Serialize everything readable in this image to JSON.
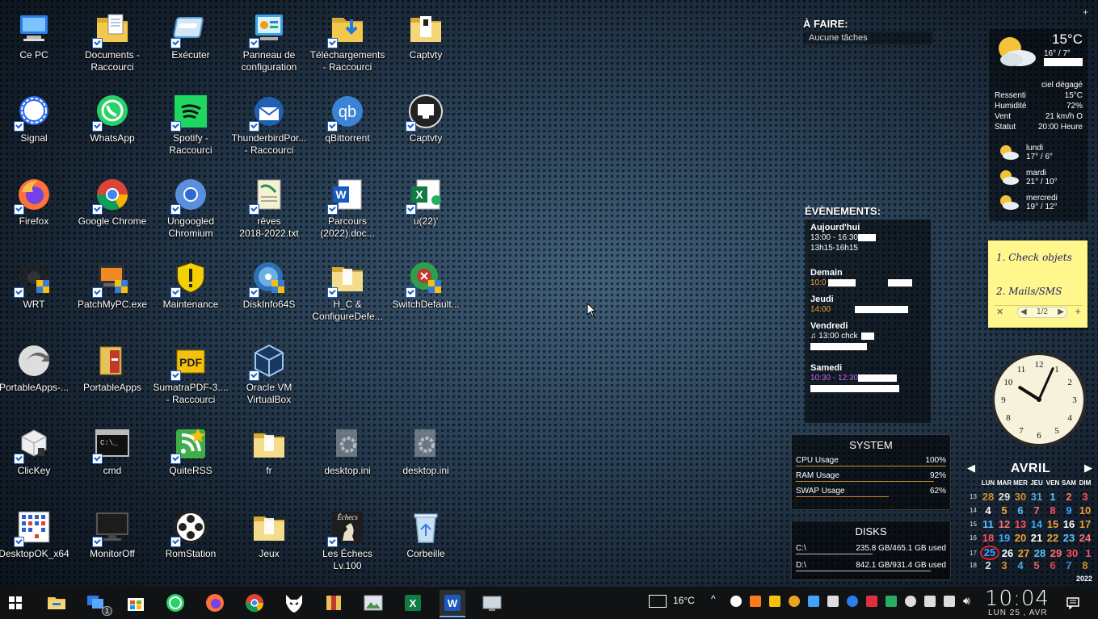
{
  "desktop": {
    "icons": [
      {
        "label": "Ce PC",
        "icon": "computer-icon",
        "shortcut": false
      },
      {
        "label": "Documents -\nRaccourci",
        "icon": "documents-folder-icon",
        "shortcut": true
      },
      {
        "label": "Exécuter",
        "icon": "run-icon",
        "shortcut": true
      },
      {
        "label": "Panneau de\nconfiguration",
        "icon": "control-panel-icon",
        "shortcut": true
      },
      {
        "label": "Téléchargements\n- Raccourci",
        "icon": "downloads-folder-icon",
        "shortcut": true
      },
      {
        "label": "Captvty",
        "icon": "captvty-folder-icon",
        "shortcut": false
      },
      {
        "label": "Signal",
        "icon": "signal-icon",
        "shortcut": true
      },
      {
        "label": "WhatsApp",
        "icon": "whatsapp-icon",
        "shortcut": true
      },
      {
        "label": "Spotify -\nRaccourci",
        "icon": "spotify-icon",
        "shortcut": true
      },
      {
        "label": "ThunderbirdPor...\n- Raccourci",
        "icon": "thunderbird-icon",
        "shortcut": true
      },
      {
        "label": "qBittorrent",
        "icon": "qbittorrent-icon",
        "shortcut": true
      },
      {
        "label": "Captvty",
        "icon": "captvty-icon",
        "shortcut": true
      },
      {
        "label": "Firefox",
        "icon": "firefox-icon",
        "shortcut": true
      },
      {
        "label": "Google Chrome",
        "icon": "chrome-icon",
        "shortcut": true
      },
      {
        "label": "Ungoogled\nChromium",
        "icon": "chromium-icon",
        "shortcut": true
      },
      {
        "label": "rêves\n2018-2022.txt",
        "icon": "text-file-icon",
        "shortcut": true
      },
      {
        "label": "Parcours\n(2022).doc...",
        "icon": "word-document-icon",
        "shortcut": true
      },
      {
        "label": "u(22)'",
        "icon": "excel-document-icon",
        "shortcut": true
      },
      {
        "label": "WRT",
        "icon": "wrt-gear-icon",
        "shortcut": true
      },
      {
        "label": "PatchMyPC.exe",
        "icon": "patchmypc-icon",
        "shortcut": true
      },
      {
        "label": "Maintenance",
        "icon": "warning-shield-icon",
        "shortcut": true
      },
      {
        "label": "DiskInfo64S",
        "icon": "diskinfo-icon",
        "shortcut": true
      },
      {
        "label": "H_C &\nConfigureDefe...",
        "icon": "folder-icon",
        "shortcut": true
      },
      {
        "label": "SwitchDefault...",
        "icon": "switchdefault-icon",
        "shortcut": true
      },
      {
        "label": "PortableApps-...",
        "icon": "portableapps-setup-icon",
        "shortcut": false
      },
      {
        "label": "PortableApps",
        "icon": "portableapps-icon",
        "shortcut": false
      },
      {
        "label": "SumatraPDF-3....\n- Raccourci",
        "icon": "sumatrapdf-icon",
        "shortcut": true
      },
      {
        "label": "Oracle VM\nVirtualBox",
        "icon": "virtualbox-icon",
        "shortcut": true
      },
      {
        "label": "",
        "icon": "",
        "shortcut": false
      },
      {
        "label": "",
        "icon": "",
        "shortcut": false
      },
      {
        "label": "ClicKey",
        "icon": "clickey-icon",
        "shortcut": true
      },
      {
        "label": "cmd",
        "icon": "cmd-icon",
        "shortcut": true
      },
      {
        "label": "QuiteRSS",
        "icon": "quiterss-icon",
        "shortcut": true
      },
      {
        "label": "fr",
        "icon": "folder-icon",
        "shortcut": false
      },
      {
        "label": "desktop.ini",
        "icon": "ini-file-icon",
        "shortcut": false
      },
      {
        "label": "desktop.ini",
        "icon": "ini-file-icon",
        "shortcut": false
      },
      {
        "label": "DesktopOK_x64",
        "icon": "desktopok-icon",
        "shortcut": true
      },
      {
        "label": "MonitorOff",
        "icon": "monitor-icon",
        "shortcut": true
      },
      {
        "label": "RomStation",
        "icon": "romstation-icon",
        "shortcut": true
      },
      {
        "label": "Jeux",
        "icon": "folder-icon",
        "shortcut": false
      },
      {
        "label": "Les Échecs Lv.100",
        "icon": "chess-icon",
        "shortcut": true
      },
      {
        "label": "Corbeille",
        "icon": "recycle-bin-icon",
        "shortcut": false
      }
    ]
  },
  "todo": {
    "title": "À FAIRE:",
    "empty": "Aucune tâches"
  },
  "events": {
    "title": "ÉVÈNEMENTS:",
    "days": [
      {
        "day": "Aujourd'hui",
        "lines": [
          "13:00 - 16:30",
          "13h15-16h15"
        ],
        "color": "#ffffff"
      },
      {
        "day": "Demain",
        "lines": [
          "10:0           10 h"
        ],
        "color": "#f0a030"
      },
      {
        "day": "Jeudi",
        "lines": [
          "14:00"
        ],
        "color": "#f0a030"
      },
      {
        "day": "Vendredi",
        "lines": [
          "13:00 chck"
        ],
        "color": "#ffffff"
      },
      {
        "day": "Samedi",
        "lines": [
          "10:30 - 12:30"
        ],
        "color": "#d060f0"
      }
    ]
  },
  "system": {
    "title": "SYSTEM",
    "rows": [
      {
        "label": "CPU Usage",
        "value": "100%",
        "level": 1.0
      },
      {
        "label": "RAM Usage",
        "value": "92%",
        "level": 0.92
      },
      {
        "label": "SWAP Usage",
        "value": "62%",
        "level": 0.62
      }
    ]
  },
  "disks": {
    "title": "DISKS",
    "rows": [
      {
        "drive": "C:\\",
        "value": "235.8 GB/465.1 GB used",
        "level": 0.51
      },
      {
        "drive": "D:\\",
        "value": "842.1 GB/931.4 GB used",
        "level": 0.9
      }
    ]
  },
  "weather": {
    "temp": "15°C",
    "minmax": "16° / 7°",
    "condition": "ciel dégagé",
    "details": [
      {
        "k": "Ressenti",
        "v": "15°C"
      },
      {
        "k": "Humidité",
        "v": "72%"
      },
      {
        "k": "Vent",
        "v": "21 km/h O"
      },
      {
        "k": "Statut",
        "v": "20:00 Heure"
      }
    ],
    "forecast": [
      {
        "day": "lundi",
        "temps": "17° / 6°"
      },
      {
        "day": "mardi",
        "temps": "21° / 10°"
      },
      {
        "day": "mercredi",
        "temps": "19° / 12°"
      }
    ]
  },
  "note": {
    "line1": "1. Check objets",
    "line2": "2. Mails/SMS",
    "pager": "1/2"
  },
  "clock": {
    "hour": 10,
    "minute": 4
  },
  "calendar": {
    "month": "AVRIL",
    "year": "2022",
    "dows": [
      "LUN",
      "MAR",
      "MER",
      "JEU",
      "VEN",
      "SAM",
      "DIM"
    ],
    "weeks": [
      {
        "wk": "13",
        "days": [
          "28",
          "29",
          "30",
          "31",
          "1",
          "2",
          "3"
        ]
      },
      {
        "wk": "14",
        "days": [
          "4",
          "5",
          "6",
          "7",
          "8",
          "9",
          "10"
        ]
      },
      {
        "wk": "15",
        "days": [
          "11",
          "12",
          "13",
          "14",
          "15",
          "16",
          "17"
        ]
      },
      {
        "wk": "16",
        "days": [
          "18",
          "19",
          "20",
          "21",
          "22",
          "23",
          "24"
        ]
      },
      {
        "wk": "17",
        "days": [
          "25",
          "26",
          "27",
          "28",
          "29",
          "30",
          "1"
        ]
      },
      {
        "wk": "18",
        "days": [
          "2",
          "3",
          "4",
          "5",
          "6",
          "7",
          "8"
        ]
      }
    ],
    "today": "25"
  },
  "taskbar": {
    "apps": [
      "start-icon",
      "file-explorer-icon",
      "multi-window-icon",
      "microsoft-store-icon",
      "whatsapp-icon",
      "firefox-icon",
      "chrome-icon",
      "fox-mask-icon",
      "archive-icon",
      "image-viewer-icon",
      "excel-icon",
      "word-icon",
      "remote-desktop-icon"
    ],
    "badge": "1",
    "weather_temp": "16°C",
    "time": "10:04",
    "date": "LUN 25 , AVR"
  }
}
